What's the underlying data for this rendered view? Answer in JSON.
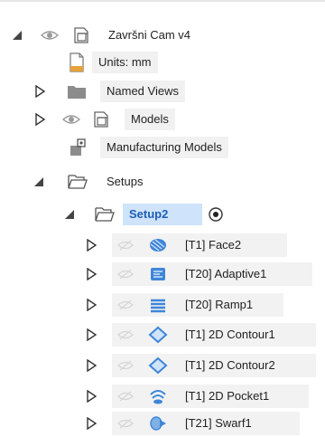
{
  "colors": {
    "active_bg": "#cfe3fb",
    "active_text": "#1d5fb4",
    "row_bg": "#f1f1f1",
    "icon_blue": "#3f86d8",
    "eye_gray": "#9a9a9a"
  },
  "tree": {
    "root": {
      "label": "Završni Cam v4",
      "expanded": true,
      "icon": "component-icon"
    },
    "units": {
      "label": "Units: mm",
      "icon": "document-icon"
    },
    "named_views": {
      "label": "Named Views",
      "expanded": false,
      "icon": "folder-icon"
    },
    "models": {
      "label": "Models",
      "expanded": false,
      "icon": "component-icon"
    },
    "manufacturing_models": {
      "label": "Manufacturing Models",
      "icon": "manufacturing-model-icon"
    },
    "setups": {
      "label": "Setups",
      "expanded": true,
      "icon": "folder-open-icon"
    },
    "setup2": {
      "label": "Setup2",
      "expanded": true,
      "active": true,
      "icon": "folder-open-icon"
    },
    "operations": [
      {
        "label": "[T1] Face2",
        "icon": "face-op-icon"
      },
      {
        "label": "[T20] Adaptive1",
        "icon": "adaptive-op-icon"
      },
      {
        "label": "[T20] Ramp1",
        "icon": "ramp-op-icon"
      },
      {
        "label": "[T1] 2D Contour1",
        "icon": "contour-op-icon"
      },
      {
        "label": "[T1] 2D Contour2",
        "icon": "contour-op-icon"
      },
      {
        "label": "[T1] 2D Pocket1",
        "icon": "pocket-op-icon"
      },
      {
        "label": "[T21] Swarf1",
        "icon": "swarf-op-icon"
      }
    ]
  }
}
